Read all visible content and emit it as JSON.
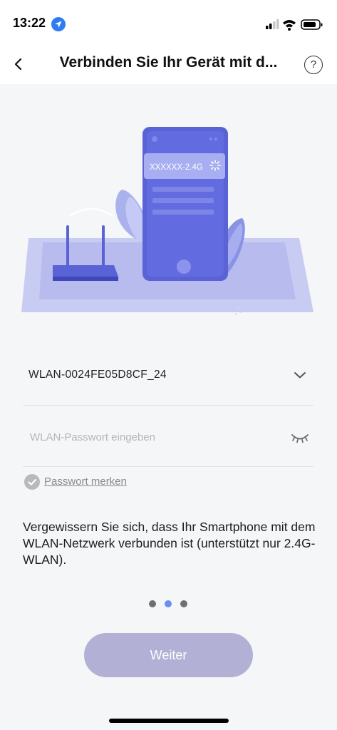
{
  "status_bar": {
    "time": "13:22"
  },
  "nav": {
    "title": "Verbinden Sie Ihr Gerät mit d...",
    "help_label": "?"
  },
  "illustration": {
    "network_name": "XXXXXX-2.4G"
  },
  "wifi_form": {
    "ssid_value": "WLAN-0024FE05D8CF_24",
    "password_placeholder": "WLAN-Passwort eingeben",
    "password_value": "",
    "remember_label": "Passwort merken"
  },
  "hint_text": "Vergewissern Sie sich, dass Ihr Smartphone mit dem WLAN-Netzwerk verbunden ist (unterstützt nur 2.4G-WLAN).",
  "pager": {
    "total": 3,
    "active_index": 1
  },
  "next_button": {
    "label": "Weiter",
    "enabled": false
  },
  "colors": {
    "accent": "#6b8ef0",
    "button_disabled": "#b3b0d6",
    "phone_blue": "#5a63d6",
    "location_badge": "#2f7bf5"
  }
}
